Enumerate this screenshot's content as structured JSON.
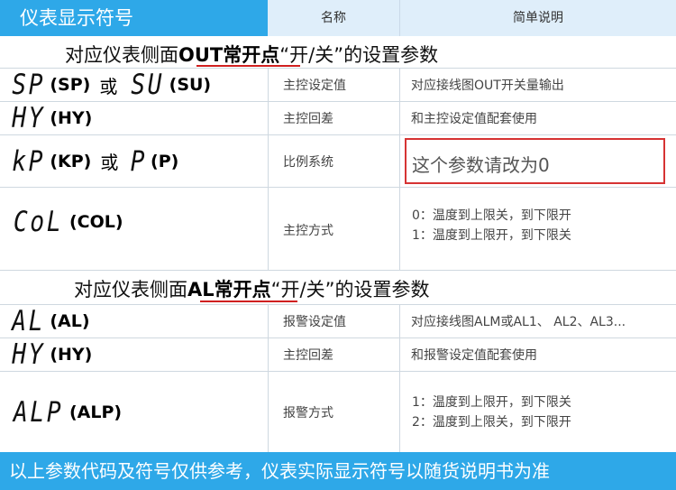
{
  "header": {
    "title": "仪表显示符号",
    "col_name": "名称",
    "col_desc": "简单说明"
  },
  "section1": {
    "prefix": "对应仪表侧面",
    "highlight": "OUT常开点",
    "suffix": "“开/关”的设置参数"
  },
  "section2": {
    "prefix": "对应仪表侧面",
    "highlight": "AL常开点",
    "suffix": "“开/关”的设置参数"
  },
  "rows": [
    {
      "seg_a": "SP",
      "code_a": "(SP)",
      "or": "或",
      "seg_b": "SU",
      "code_b": "(SU)",
      "name": "主控设定值",
      "desc": "对应接线图OUT开关量输出"
    },
    {
      "seg_a": "HY",
      "code_a": "(HY)",
      "name": "主控回差",
      "desc": "和主控设定值配套使用"
    },
    {
      "seg_a": "kP",
      "code_a": "(KP)",
      "or": "或",
      "seg_b": "P",
      "code_b": "(P)",
      "name": "比例系统",
      "desc": "这个参数请改为0"
    },
    {
      "seg_a": "CoL",
      "code_a": "(COL)",
      "name": "主控方式",
      "desc_lines": [
        "0：温度到上限关，到下限开",
        "1：温度到上限开，到下限关"
      ]
    },
    {
      "seg_a": "AL",
      "code_a": "(AL)",
      "name": "报警设定值",
      "desc": "对应接线图ALM或AL1、 AL2、AL3..."
    },
    {
      "seg_a": "HY",
      "code_a": "(HY)",
      "name": "主控回差",
      "desc": "和报警设定值配套使用"
    },
    {
      "seg_a": "ALP",
      "code_a": "(ALP)",
      "name": "报警方式",
      "desc_lines": [
        "1：温度到上限开，到下限关",
        "2：温度到上限关，到下限开"
      ]
    }
  ],
  "footer": {
    "text": "以上参数代码及符号仅供参考，仪表实际显示符号以随货说明书为准"
  },
  "colors": {
    "header_blue": "#2ea8e8",
    "header_light": "#dfeefa",
    "underline_red": "#d02020",
    "box_red": "#d63333"
  }
}
